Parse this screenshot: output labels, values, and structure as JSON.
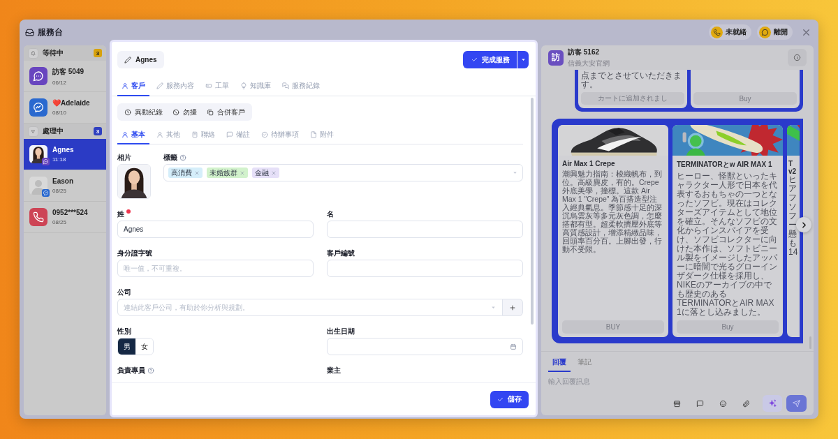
{
  "window": {
    "title": "服務台"
  },
  "header_actions": [
    {
      "kind": "status",
      "label": "未就緒"
    },
    {
      "kind": "leave",
      "label": "離開"
    }
  ],
  "queue": [
    {
      "kind": "waiting",
      "label": "等待中",
      "count": "3",
      "color": "#d8a20c",
      "items": [
        {
          "name": "訪客 5049",
          "time": "06/12",
          "kind": "chat",
          "selected": false
        },
        {
          "name": "❤️Adelaide",
          "time": "08/10",
          "kind": "messenger",
          "selected": false
        }
      ]
    },
    {
      "kind": "active",
      "label": "處理中",
      "count": "3",
      "color": "#2f3fc0",
      "items": [
        {
          "name": "Agnes",
          "time": "11:18",
          "kind": "photo_chat",
          "selected": true
        },
        {
          "name": "Eason",
          "time": "08/25",
          "kind": "silhouette_messenger",
          "selected": false
        },
        {
          "name": "0952***524",
          "time": "08/25",
          "kind": "phone",
          "selected": false
        }
      ]
    }
  ],
  "customer": {
    "name": "Agnes",
    "primary_action": "完成服務",
    "tabs": [
      {
        "kind": "customer",
        "label": "客戶",
        "selected": true
      },
      {
        "kind": "service",
        "label": "服務內容",
        "selected": false
      },
      {
        "kind": "ticket",
        "label": "工單",
        "selected": false
      },
      {
        "kind": "knowledge",
        "label": "知識庫",
        "selected": false
      },
      {
        "kind": "history",
        "label": "服務紀錄",
        "selected": false
      }
    ],
    "actions": [
      {
        "kind": "history",
        "label": "異動紀錄"
      },
      {
        "kind": "dnd",
        "label": "勿擾"
      },
      {
        "kind": "merge",
        "label": "合併客戶"
      }
    ],
    "subtabs": [
      {
        "kind": "basic",
        "label": "基本",
        "selected": true
      },
      {
        "kind": "other",
        "label": "其他",
        "selected": false
      },
      {
        "kind": "contact",
        "label": "聯絡",
        "selected": false
      },
      {
        "kind": "note",
        "label": "備註",
        "selected": false
      },
      {
        "kind": "todo",
        "label": "待辦事項",
        "selected": false
      },
      {
        "kind": "attachment",
        "label": "附件",
        "selected": false
      }
    ],
    "photo_label": "相片",
    "tags": {
      "label": "標籤",
      "help": true,
      "items": [
        {
          "label": "高消費",
          "color": "#d5eefa"
        },
        {
          "label": "未婚族群",
          "color": "#d2f2cc"
        },
        {
          "label": "金融",
          "color": "#e6e0f8"
        }
      ]
    },
    "field_rows": [
      [
        {
          "kind": "text",
          "label": "姓",
          "required": true,
          "help": false,
          "value": "Agnes"
        },
        {
          "kind": "text",
          "label": "名",
          "required": false,
          "help": false
        }
      ],
      [
        {
          "kind": "text",
          "label": "身分證字號",
          "required": false,
          "help": false,
          "placeholder": "唯一值，不可重複。"
        },
        {
          "kind": "text",
          "label": "客戶編號",
          "required": false,
          "help": false
        }
      ],
      [
        {
          "kind": "select_add",
          "label": "公司",
          "required": false,
          "help": false,
          "placeholder": "連結此客戶公司，有助於你分析與規劃。"
        }
      ],
      [
        {
          "kind": "segmented",
          "label": "性別",
          "required": false,
          "help": false,
          "options": [
            {
              "label": "男",
              "selected": true
            },
            {
              "label": "女",
              "selected": false
            }
          ]
        },
        {
          "kind": "date",
          "label": "出生日期",
          "required": false,
          "help": false
        }
      ],
      [
        {
          "kind": "label",
          "label": "負責專員",
          "required": false,
          "help": true
        },
        {
          "kind": "label",
          "label": "業主",
          "required": false,
          "help": false
        }
      ]
    ],
    "save": "儲存"
  },
  "chat": {
    "visitor": {
      "avatar": "訪",
      "name": "訪客 5162",
      "source": "信義大安官網"
    },
    "earlier_cards": [
      {
        "text": "点までとさせていただきます。",
        "button": "カートに追加されまし"
      },
      {
        "button": "Buy"
      }
    ],
    "carousel": [
      {
        "kind": "product",
        "title": "Air Max 1 Crepe",
        "body": "潮興魅力指南：梭織帆布，到位。高級麂皮，有的。Crepe 外底美學，撞標。這款 Air Max 1 \"Crepe\" 為百搭造型注入經典氣息。季節感十足的深沉烏雲灰等多元灰色調，怎麼搭都有型。超柔軟擠壓外底等高質感設計，增添精緻品味，回頭率百分百。上腳出發，行動不受限。",
        "button": "BUY"
      },
      {
        "kind": "product",
        "title": "TERMINATORとw AIR MAX 1",
        "body": "ヒーロー、怪獣といったキャラクター人形で日本を代表するおもちゃの一つとなったソフビ。現在はコレクターズアイテムとして地位を確立。そんなソフビの文化からインスパイアを受け、ソフビコレクターに向けた本作は、ソフトビニール製をイメージしたアッパーに暗闇で光るグローインザダーク仕様を採用し、NIKEのアーカイブの中でも歴史のあるTERMINATORとAIR MAX 1に落とし込みました。",
        "button": "Buy"
      },
      {
        "kind": "edge",
        "title": "T",
        "title_2": "v2",
        "lines": [
          "ヒ",
          "ア",
          "フ",
          "ソ",
          "フ",
          "ー",
          "懸",
          "も",
          "14"
        ]
      }
    ],
    "reply": {
      "tabs": [
        {
          "label": "回覆",
          "selected": true
        },
        {
          "label": "筆記",
          "selected": false
        }
      ],
      "placeholder": "輸入回覆訊息"
    }
  }
}
